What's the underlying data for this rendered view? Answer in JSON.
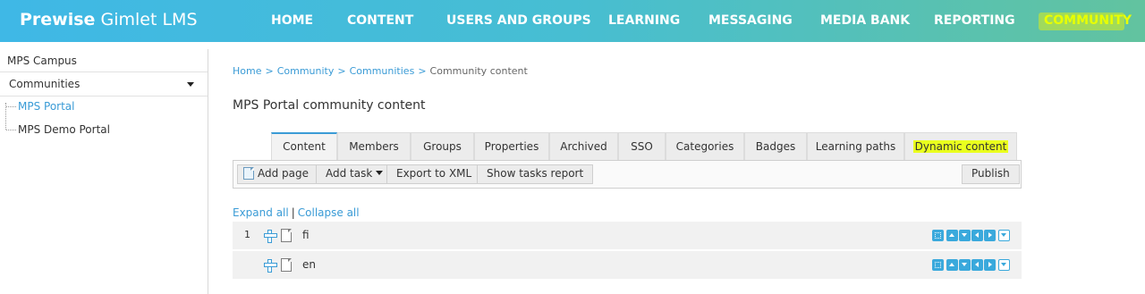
{
  "app": {
    "brand_bold": "Prewise",
    "brand_rest": "Gimlet LMS"
  },
  "nav": {
    "items": [
      {
        "label": "HOME"
      },
      {
        "label": "CONTENT"
      },
      {
        "label": "USERS AND GROUPS"
      },
      {
        "label": "LEARNING"
      },
      {
        "label": "MESSAGING"
      },
      {
        "label": "MEDIA BANK"
      },
      {
        "label": "REPORTING"
      },
      {
        "label": "COMMUNITY",
        "active": true
      }
    ]
  },
  "sidebar": {
    "campus": "MPS Campus",
    "selector": "Communities",
    "tree": [
      {
        "label": "MPS Portal",
        "selected": true
      },
      {
        "label": "MPS Demo Portal"
      }
    ]
  },
  "breadcrumb": {
    "links": [
      "Home",
      "Community",
      "Communities"
    ],
    "current": "Community content",
    "separator": ">"
  },
  "page": {
    "title": "MPS Portal community content"
  },
  "tabs": [
    {
      "label": "Content",
      "active": true
    },
    {
      "label": "Members"
    },
    {
      "label": "Groups"
    },
    {
      "label": "Properties"
    },
    {
      "label": "Archived"
    },
    {
      "label": "SSO"
    },
    {
      "label": "Categories"
    },
    {
      "label": "Badges"
    },
    {
      "label": "Learning paths"
    },
    {
      "label": "Dynamic content",
      "highlighted": true
    }
  ],
  "toolbar": {
    "add_page": "Add page",
    "add_task": "Add task",
    "export_xml": "Export to XML",
    "show_tasks_report": "Show tasks report",
    "publish": "Publish"
  },
  "tree_controls": {
    "expand_all": "Expand all",
    "separator": "|",
    "collapse_all": "Collapse all"
  },
  "content_rows": [
    {
      "number": "1",
      "language": "fi",
      "icon": "page-icon"
    },
    {
      "number": "",
      "language": "en",
      "icon": "page-icon"
    }
  ],
  "colors": {
    "header_gradient_start": "#3fb8e6",
    "header_gradient_end": "#62c39f",
    "link": "#3a9bd6",
    "highlight": "#eaff1e",
    "action_icon": "#3aa9dc"
  }
}
